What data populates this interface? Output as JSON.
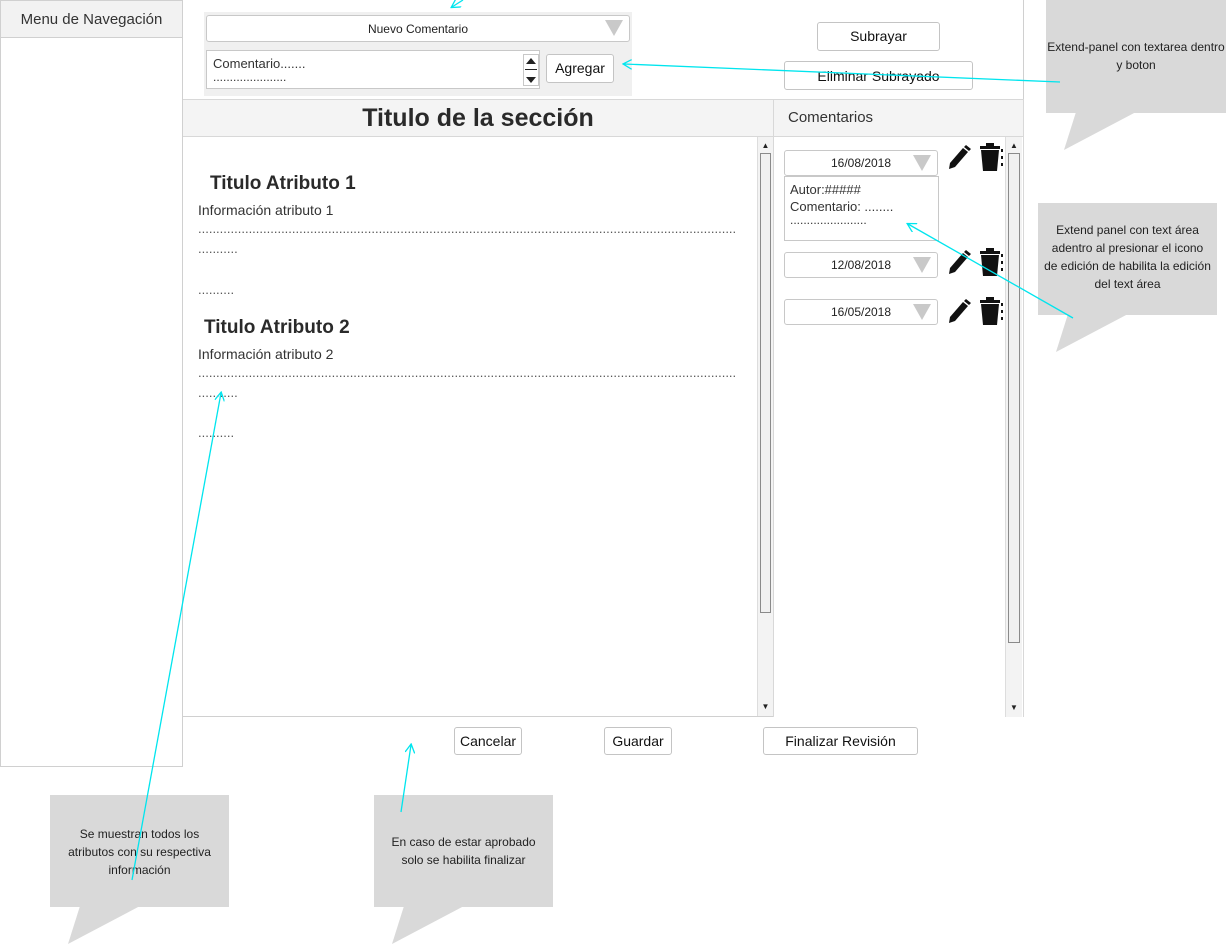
{
  "nav": {
    "title": "Menu de Navegación"
  },
  "toolbar": {
    "new_comment_select": "Nuevo Comentario",
    "comment_textarea_line1": "Comentario.......",
    "comment_textarea_line2": "......................",
    "add_button": "Agregar",
    "underline_button": "Subrayar",
    "remove_underline_button": "Eliminar Subrayado"
  },
  "section": {
    "title": "Titulo de la sección",
    "attributes": [
      {
        "title": "Titulo Atributo 1",
        "info": "Información atributo 1",
        "dots_long": "..........................................................................................................................................................",
        "dots_short1": "...........",
        "dots_short2": ".........."
      },
      {
        "title": "Titulo Atributo 2",
        "info": "Información atributo 2",
        "dots_long": "..........................................................................................................................................................",
        "dots_short1": "...........",
        "dots_short2": ".........."
      }
    ]
  },
  "comments": {
    "title": "Comentarios",
    "items": [
      {
        "date": "16/08/2018",
        "author": "Autor:#####",
        "text_line1": "Comentario: ........",
        "text_line2": "......................."
      },
      {
        "date": "12/08/2018"
      },
      {
        "date": "16/05/2018"
      }
    ]
  },
  "footer": {
    "cancel": "Cancelar",
    "save": "Guardar",
    "finish": "Finalizar Revisión"
  },
  "callouts": {
    "extend_panel": "Extend-panel con textarea dentro y boton",
    "edit_panel": "Extend panel con text área adentro al presionar el icono de edición de habilita la edición del text área",
    "attributes": "Se muestran todos los atributos con su respectiva información",
    "approved": "En caso de estar aprobado solo se habilita finalizar"
  },
  "colors": {
    "annotation_arrow": "#00e5ee",
    "callout_bg": "#d9d9d9"
  },
  "icons": [
    "pencil-icon",
    "trash-icon",
    "dropdown-triangle-icon",
    "scroll-up-icon",
    "scroll-down-icon"
  ]
}
